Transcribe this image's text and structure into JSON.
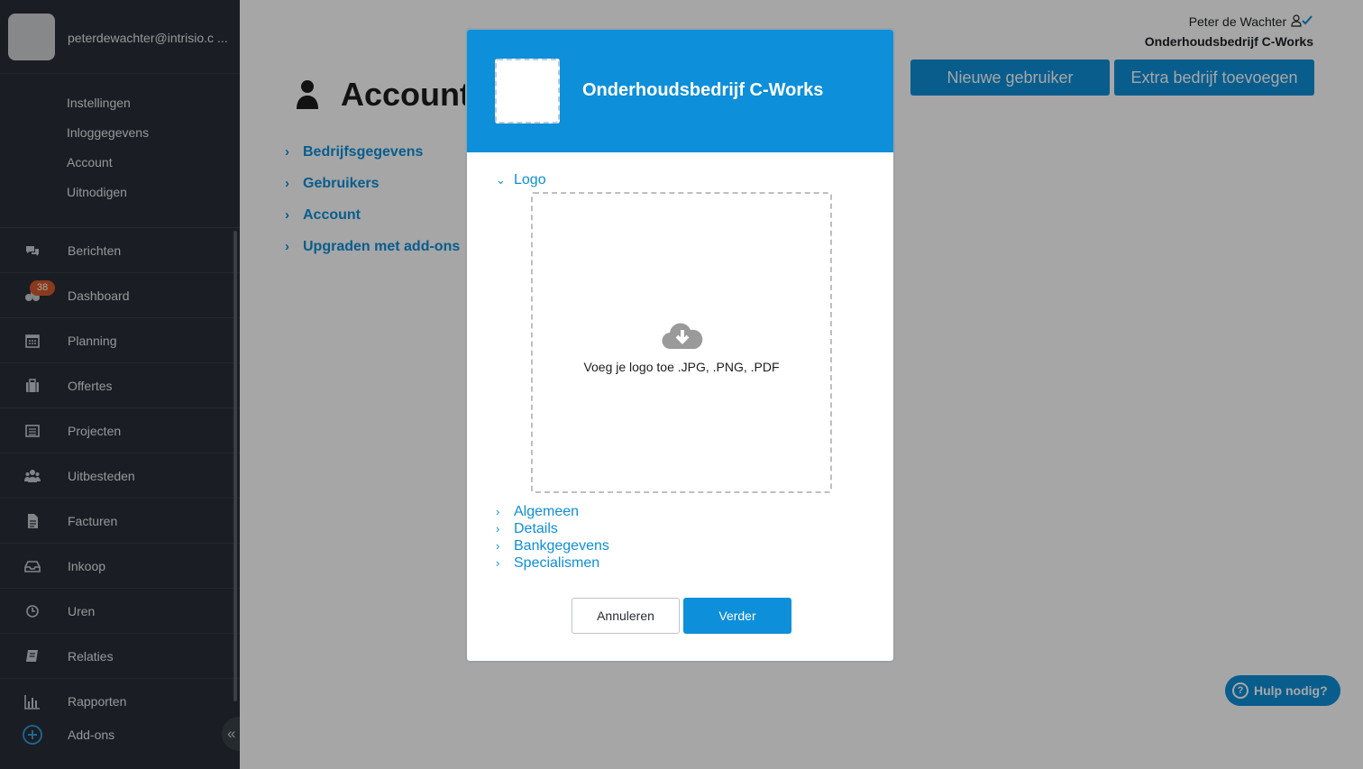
{
  "sidebar": {
    "email": "peterdewachter@intrisio.c ...",
    "sub_items": [
      {
        "label": "Instellingen"
      },
      {
        "label": "Inloggegevens"
      },
      {
        "label": "Account"
      },
      {
        "label": "Uitnodigen"
      }
    ],
    "nav": [
      {
        "label": "Berichten",
        "icon": "chat-icon"
      },
      {
        "label": "Dashboard",
        "icon": "dashboard-icon",
        "badge": "38"
      },
      {
        "label": "Planning",
        "icon": "calendar-icon"
      },
      {
        "label": "Offertes",
        "icon": "briefcase-icon"
      },
      {
        "label": "Projecten",
        "icon": "list-icon"
      },
      {
        "label": "Uitbesteden",
        "icon": "users-icon"
      },
      {
        "label": "Facturen",
        "icon": "document-icon"
      },
      {
        "label": "Inkoop",
        "icon": "inbox-icon"
      },
      {
        "label": "Uren",
        "icon": "clock-icon"
      },
      {
        "label": "Relaties",
        "icon": "book-icon"
      },
      {
        "label": "Rapporten",
        "icon": "bar-chart-icon"
      }
    ],
    "addons_label": "Add-ons",
    "collapse_label": "«"
  },
  "header": {
    "user_name": "Peter de Wachter",
    "company": "Onderhoudsbedrijf C-Works",
    "new_user_button": "Nieuwe gebruiker",
    "add_company_button": "Extra bedrijf toevoegen"
  },
  "page": {
    "title": "Account",
    "links": [
      "Bedrijfsgegevens",
      "Gebruikers",
      "Account",
      "Upgraden met add-ons"
    ]
  },
  "help_button": "Hulp nodig?",
  "modal": {
    "company": "Onderhoudsbedrijf C-Works",
    "logo_section": "Logo",
    "dropzone_text": "Voeg je logo toe .JPG, .PNG, .PDF",
    "sections": [
      "Algemeen",
      "Details",
      "Bankgegevens",
      "Specialismen"
    ],
    "cancel_button": "Annuleren",
    "next_button": "Verder"
  },
  "colors": {
    "accent": "#0d8fd9",
    "sidebar_bg": "#282f38",
    "badge": "#d55a2c"
  }
}
